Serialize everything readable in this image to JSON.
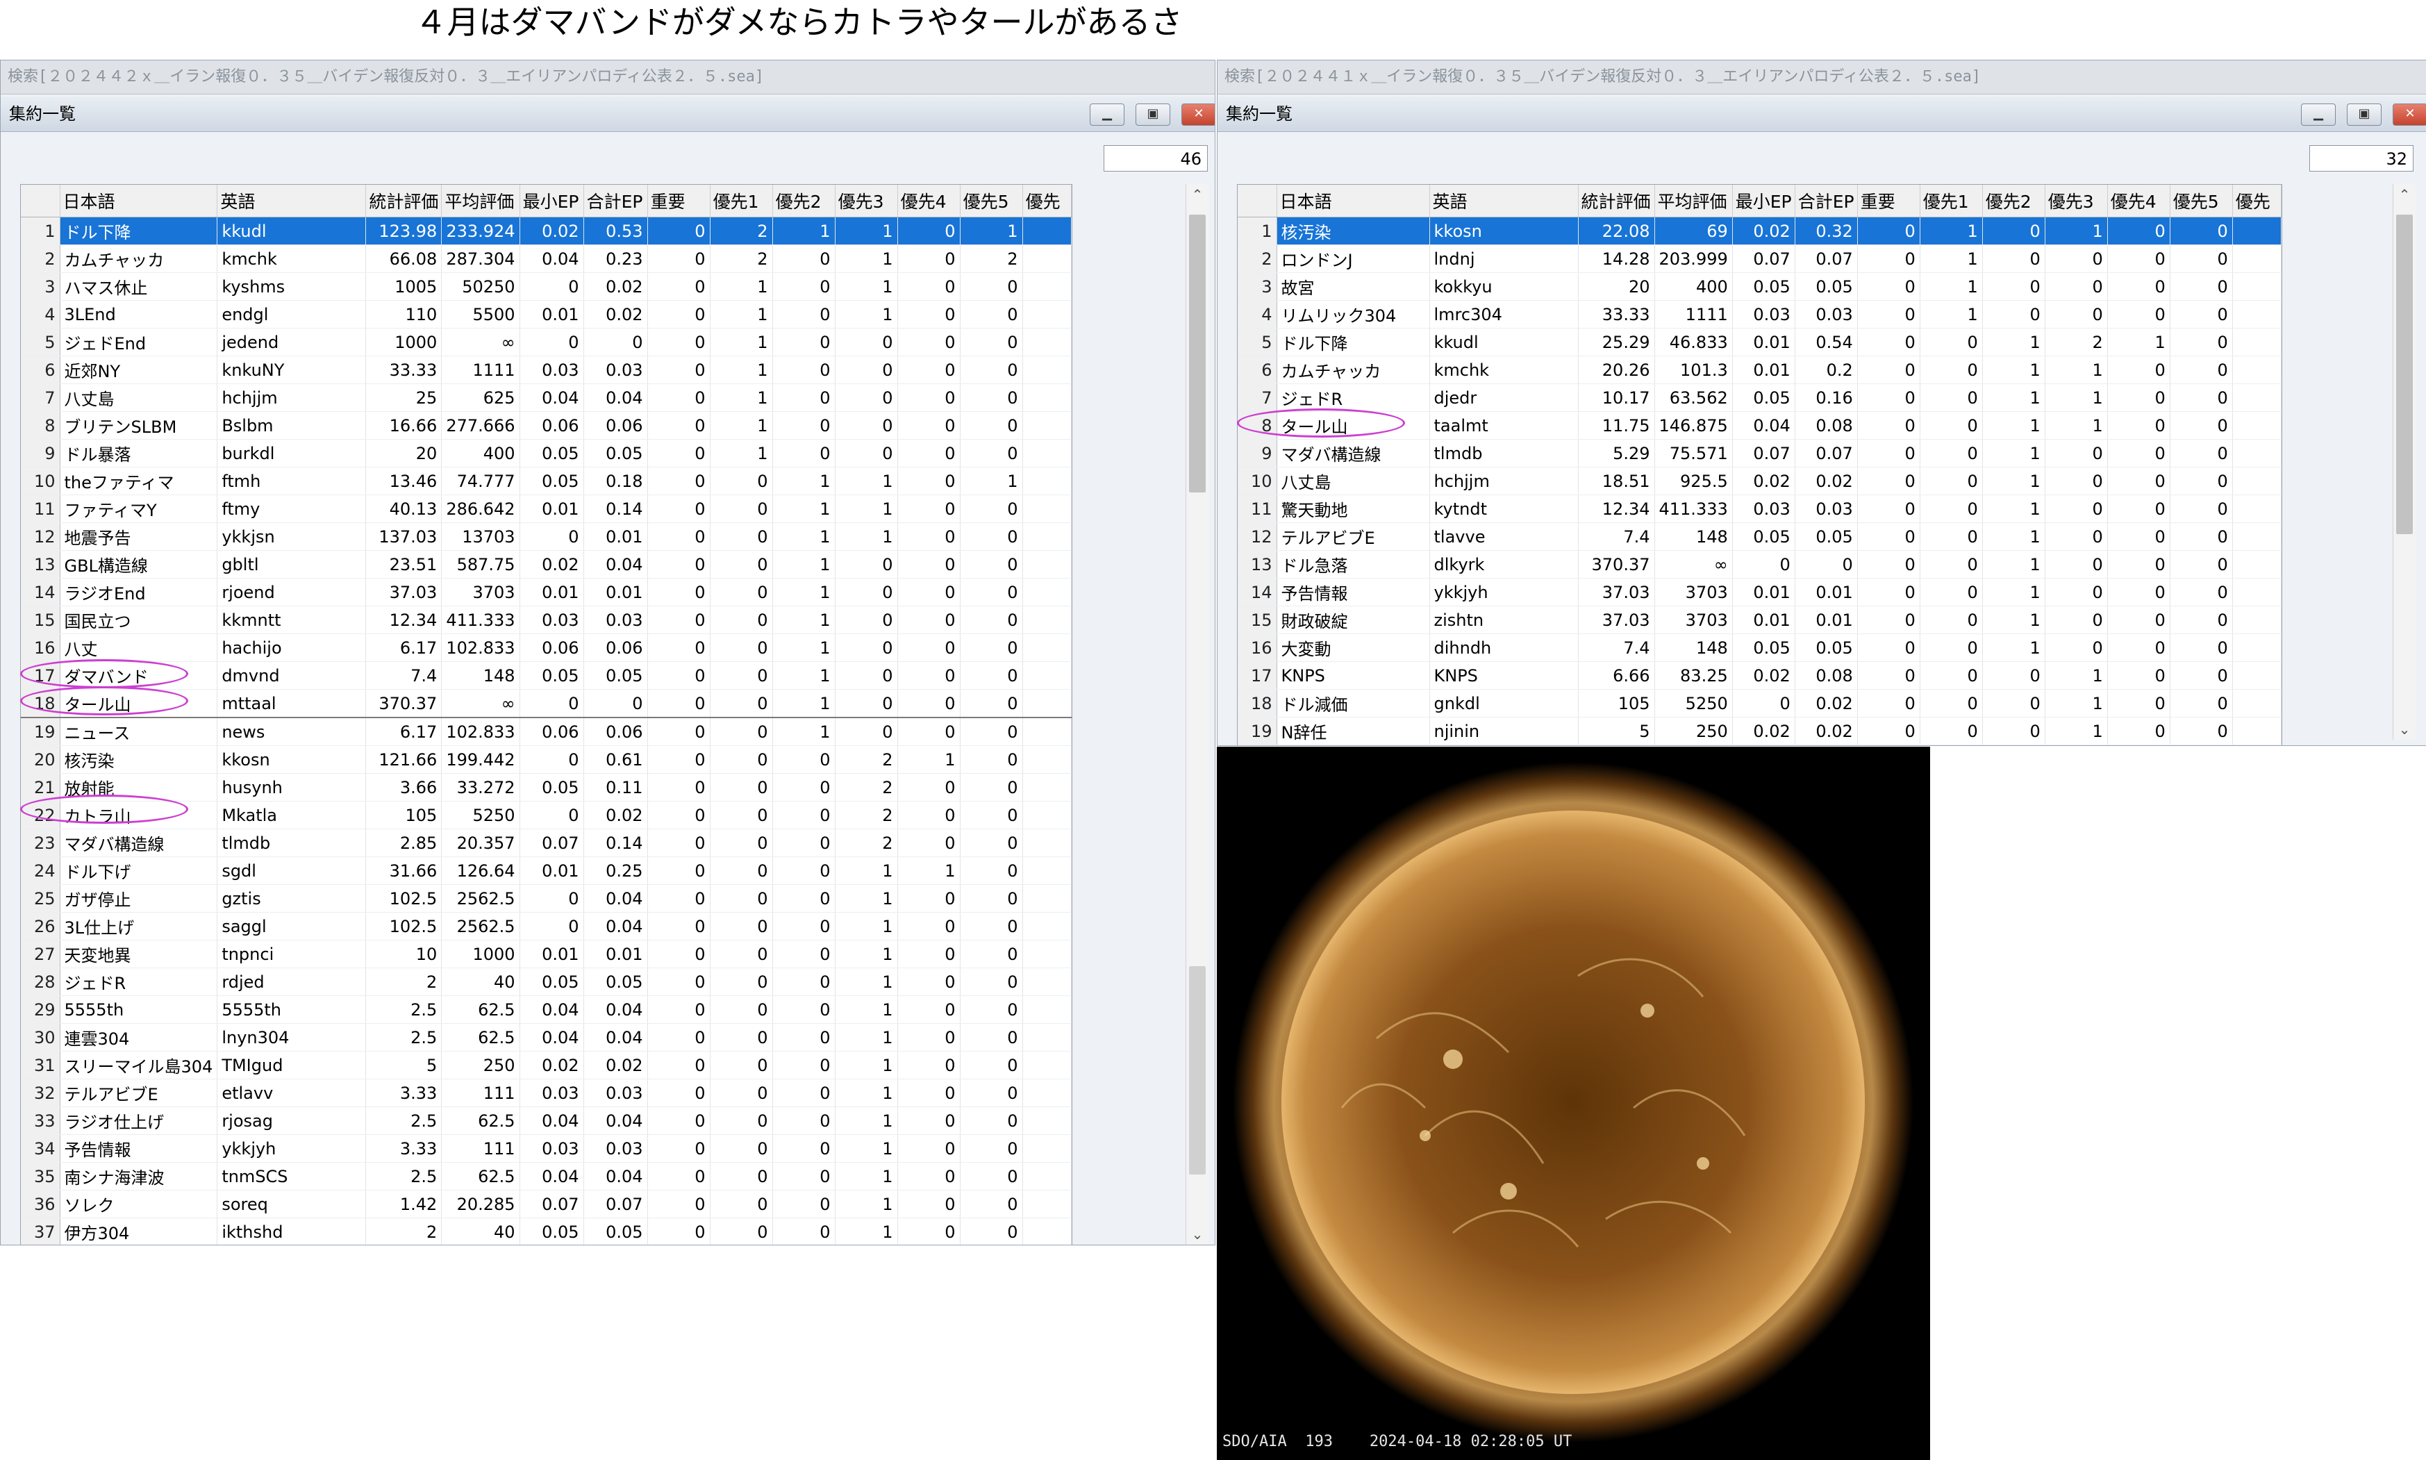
{
  "title": "４月はダマバンドがダメならカトラやタールがあるさ",
  "left": {
    "search_text": "検索[２０２４４２ｘ＿イラン報復０．３５＿バイデン報復反対０．３＿エイリアンパロディ公表２．５.sea]",
    "window_title": "集約一覧",
    "count": "46",
    "columns": [
      "日本語",
      "英語",
      "統計評価",
      "平均評価",
      "最小EP",
      "合計EP",
      "重要",
      "優先1",
      "優先2",
      "優先3",
      "優先4",
      "優先5",
      "優先"
    ],
    "rows": [
      [
        "1",
        "ドル下降",
        "kkudl",
        "123.98",
        "233.924",
        "0.02",
        "0.53",
        "0",
        "2",
        "1",
        "1",
        "0",
        "1",
        ""
      ],
      [
        "2",
        "カムチャッカ",
        "kmchk",
        "66.08",
        "287.304",
        "0.04",
        "0.23",
        "0",
        "2",
        "0",
        "1",
        "0",
        "2",
        ""
      ],
      [
        "3",
        "ハマス休止",
        "kyshms",
        "1005",
        "50250",
        "0",
        "0.02",
        "0",
        "1",
        "0",
        "1",
        "0",
        "0",
        ""
      ],
      [
        "4",
        "3LEnd",
        "endgl",
        "110",
        "5500",
        "0.01",
        "0.02",
        "0",
        "1",
        "0",
        "1",
        "0",
        "0",
        ""
      ],
      [
        "5",
        "ジェドEnd",
        "jedend",
        "1000",
        "∞",
        "0",
        "0",
        "0",
        "1",
        "0",
        "0",
        "0",
        "0",
        ""
      ],
      [
        "6",
        "近郊NY",
        "knkuNY",
        "33.33",
        "1111",
        "0.03",
        "0.03",
        "0",
        "1",
        "0",
        "0",
        "0",
        "0",
        ""
      ],
      [
        "7",
        "八丈島",
        "hchjjm",
        "25",
        "625",
        "0.04",
        "0.04",
        "0",
        "1",
        "0",
        "0",
        "0",
        "0",
        ""
      ],
      [
        "8",
        "ブリテンSLBM",
        "Bslbm",
        "16.66",
        "277.666",
        "0.06",
        "0.06",
        "0",
        "1",
        "0",
        "0",
        "0",
        "0",
        ""
      ],
      [
        "9",
        "ドル暴落",
        "burkdl",
        "20",
        "400",
        "0.05",
        "0.05",
        "0",
        "1",
        "0",
        "0",
        "0",
        "0",
        ""
      ],
      [
        "10",
        "theファティマ",
        "ftmh",
        "13.46",
        "74.777",
        "0.05",
        "0.18",
        "0",
        "0",
        "1",
        "1",
        "0",
        "1",
        ""
      ],
      [
        "11",
        "ファティマY",
        "ftmy",
        "40.13",
        "286.642",
        "0.01",
        "0.14",
        "0",
        "0",
        "1",
        "1",
        "0",
        "0",
        ""
      ],
      [
        "12",
        "地震予告",
        "ykkjsn",
        "137.03",
        "13703",
        "0",
        "0.01",
        "0",
        "0",
        "1",
        "1",
        "0",
        "0",
        ""
      ],
      [
        "13",
        "GBL構造線",
        "gbltl",
        "23.51",
        "587.75",
        "0.02",
        "0.04",
        "0",
        "0",
        "1",
        "0",
        "0",
        "0",
        ""
      ],
      [
        "14",
        "ラジオEnd",
        "rjoend",
        "37.03",
        "3703",
        "0.01",
        "0.01",
        "0",
        "0",
        "1",
        "0",
        "0",
        "0",
        ""
      ],
      [
        "15",
        "国民立つ",
        "kkmntt",
        "12.34",
        "411.333",
        "0.03",
        "0.03",
        "0",
        "0",
        "1",
        "0",
        "0",
        "0",
        ""
      ],
      [
        "16",
        "八丈",
        "hachijo",
        "6.17",
        "102.833",
        "0.06",
        "0.06",
        "0",
        "0",
        "1",
        "0",
        "0",
        "0",
        ""
      ],
      [
        "17",
        "ダマバンド",
        "dmvnd",
        "7.4",
        "148",
        "0.05",
        "0.05",
        "0",
        "0",
        "1",
        "0",
        "0",
        "0",
        ""
      ],
      [
        "18",
        "タール山",
        "mttaal",
        "370.37",
        "∞",
        "0",
        "0",
        "0",
        "0",
        "1",
        "0",
        "0",
        "0",
        ""
      ],
      [
        "19",
        "ニュース",
        "news",
        "6.17",
        "102.833",
        "0.06",
        "0.06",
        "0",
        "0",
        "1",
        "0",
        "0",
        "0",
        ""
      ],
      [
        "20",
        "核汚染",
        "kkosn",
        "121.66",
        "199.442",
        "0",
        "0.61",
        "0",
        "0",
        "0",
        "2",
        "1",
        "0",
        ""
      ],
      [
        "21",
        "放射能",
        "husynh",
        "3.66",
        "33.272",
        "0.05",
        "0.11",
        "0",
        "0",
        "0",
        "2",
        "0",
        "0",
        ""
      ],
      [
        "22",
        "カトラ山",
        "Mkatla",
        "105",
        "5250",
        "0",
        "0.02",
        "0",
        "0",
        "0",
        "2",
        "0",
        "0",
        ""
      ],
      [
        "23",
        "マダバ構造線",
        "tlmdb",
        "2.85",
        "20.357",
        "0.07",
        "0.14",
        "0",
        "0",
        "0",
        "2",
        "0",
        "0",
        ""
      ],
      [
        "24",
        "ドル下げ",
        "sgdl",
        "31.66",
        "126.64",
        "0.01",
        "0.25",
        "0",
        "0",
        "0",
        "1",
        "1",
        "0",
        ""
      ],
      [
        "25",
        "ガザ停止",
        "gztis",
        "102.5",
        "2562.5",
        "0",
        "0.04",
        "0",
        "0",
        "0",
        "1",
        "0",
        "0",
        ""
      ],
      [
        "26",
        "3L仕上げ",
        "saggl",
        "102.5",
        "2562.5",
        "0",
        "0.04",
        "0",
        "0",
        "0",
        "1",
        "0",
        "0",
        ""
      ],
      [
        "27",
        "天変地異",
        "tnpnci",
        "10",
        "1000",
        "0.01",
        "0.01",
        "0",
        "0",
        "0",
        "1",
        "0",
        "0",
        ""
      ],
      [
        "28",
        "ジェドR",
        "rdjed",
        "2",
        "40",
        "0.05",
        "0.05",
        "0",
        "0",
        "0",
        "1",
        "0",
        "0",
        ""
      ],
      [
        "29",
        "5555th",
        "5555th",
        "2.5",
        "62.5",
        "0.04",
        "0.04",
        "0",
        "0",
        "0",
        "1",
        "0",
        "0",
        ""
      ],
      [
        "30",
        "連雲304",
        "lnyn304",
        "2.5",
        "62.5",
        "0.04",
        "0.04",
        "0",
        "0",
        "0",
        "1",
        "0",
        "0",
        ""
      ],
      [
        "31",
        "スリーマイル島304",
        "TMIgud",
        "5",
        "250",
        "0.02",
        "0.02",
        "0",
        "0",
        "0",
        "1",
        "0",
        "0",
        ""
      ],
      [
        "32",
        "テルアビブE",
        "etlavv",
        "3.33",
        "111",
        "0.03",
        "0.03",
        "0",
        "0",
        "0",
        "1",
        "0",
        "0",
        ""
      ],
      [
        "33",
        "ラジオ仕上げ",
        "rjosag",
        "2.5",
        "62.5",
        "0.04",
        "0.04",
        "0",
        "0",
        "0",
        "1",
        "0",
        "0",
        ""
      ],
      [
        "34",
        "予告情報",
        "ykkjyh",
        "3.33",
        "111",
        "0.03",
        "0.03",
        "0",
        "0",
        "0",
        "1",
        "0",
        "0",
        ""
      ],
      [
        "35",
        "南シナ海津波",
        "tnmSCS",
        "2.5",
        "62.5",
        "0.04",
        "0.04",
        "0",
        "0",
        "0",
        "1",
        "0",
        "0",
        ""
      ],
      [
        "36",
        "ソレク",
        "soreq",
        "1.42",
        "20.285",
        "0.07",
        "0.07",
        "0",
        "0",
        "0",
        "1",
        "0",
        "0",
        ""
      ],
      [
        "37",
        "伊方304",
        "ikthshd",
        "2",
        "40",
        "0.05",
        "0.05",
        "0",
        "0",
        "0",
        "1",
        "0",
        "0",
        ""
      ]
    ]
  },
  "right": {
    "search_text": "検索[２０２４４１ｘ＿イラン報復０．３５＿バイデン報復反対０．３＿エイリアンパロディ公表２．５.sea]",
    "window_title": "集約一覧",
    "count": "32",
    "columns": [
      "日本語",
      "英語",
      "統計評価",
      "平均評価",
      "最小EP",
      "合計EP",
      "重要",
      "優先1",
      "優先2",
      "優先3",
      "優先4",
      "優先5",
      "優先"
    ],
    "rows": [
      [
        "1",
        "核汚染",
        "kkosn",
        "22.08",
        "69",
        "0.02",
        "0.32",
        "0",
        "1",
        "0",
        "1",
        "0",
        "0",
        ""
      ],
      [
        "2",
        "ロンドンJ",
        "lndnj",
        "14.28",
        "203.999",
        "0.07",
        "0.07",
        "0",
        "1",
        "0",
        "0",
        "0",
        "0",
        ""
      ],
      [
        "3",
        "故宮",
        "kokkyu",
        "20",
        "400",
        "0.05",
        "0.05",
        "0",
        "1",
        "0",
        "0",
        "0",
        "0",
        ""
      ],
      [
        "4",
        "リムリック304",
        "lmrc304",
        "33.33",
        "1111",
        "0.03",
        "0.03",
        "0",
        "1",
        "0",
        "0",
        "0",
        "0",
        ""
      ],
      [
        "5",
        "ドル下降",
        "kkudl",
        "25.29",
        "46.833",
        "0.01",
        "0.54",
        "0",
        "0",
        "1",
        "2",
        "1",
        "0",
        ""
      ],
      [
        "6",
        "カムチャッカ",
        "kmchk",
        "20.26",
        "101.3",
        "0.01",
        "0.2",
        "0",
        "0",
        "1",
        "1",
        "0",
        "0",
        ""
      ],
      [
        "7",
        "ジェドR",
        "djedr",
        "10.17",
        "63.562",
        "0.05",
        "0.16",
        "0",
        "0",
        "1",
        "1",
        "0",
        "0",
        ""
      ],
      [
        "8",
        "タール山",
        "taalmt",
        "11.75",
        "146.875",
        "0.04",
        "0.08",
        "0",
        "0",
        "1",
        "1",
        "0",
        "0",
        ""
      ],
      [
        "9",
        "マダバ構造線",
        "tlmdb",
        "5.29",
        "75.571",
        "0.07",
        "0.07",
        "0",
        "0",
        "1",
        "0",
        "0",
        "0",
        ""
      ],
      [
        "10",
        "八丈島",
        "hchjjm",
        "18.51",
        "925.5",
        "0.02",
        "0.02",
        "0",
        "0",
        "1",
        "0",
        "0",
        "0",
        ""
      ],
      [
        "11",
        "驚天動地",
        "kytndt",
        "12.34",
        "411.333",
        "0.03",
        "0.03",
        "0",
        "0",
        "1",
        "0",
        "0",
        "0",
        ""
      ],
      [
        "12",
        "テルアビブE",
        "tlavve",
        "7.4",
        "148",
        "0.05",
        "0.05",
        "0",
        "0",
        "1",
        "0",
        "0",
        "0",
        ""
      ],
      [
        "13",
        "ドル急落",
        "dlkyrk",
        "370.37",
        "∞",
        "0",
        "0",
        "0",
        "0",
        "1",
        "0",
        "0",
        "0",
        ""
      ],
      [
        "14",
        "予告情報",
        "ykkjyh",
        "37.03",
        "3703",
        "0.01",
        "0.01",
        "0",
        "0",
        "1",
        "0",
        "0",
        "0",
        ""
      ],
      [
        "15",
        "財政破綻",
        "zishtn",
        "37.03",
        "3703",
        "0.01",
        "0.01",
        "0",
        "0",
        "1",
        "0",
        "0",
        "0",
        ""
      ],
      [
        "16",
        "大変動",
        "dihndh",
        "7.4",
        "148",
        "0.05",
        "0.05",
        "0",
        "0",
        "1",
        "0",
        "0",
        "0",
        ""
      ],
      [
        "17",
        "KNPS",
        "KNPS",
        "6.66",
        "83.25",
        "0.02",
        "0.08",
        "0",
        "0",
        "0",
        "1",
        "0",
        "0",
        ""
      ],
      [
        "18",
        "ドル減価",
        "gnkdl",
        "105",
        "5250",
        "0",
        "0.02",
        "0",
        "0",
        "0",
        "1",
        "0",
        "0",
        ""
      ],
      [
        "19",
        "N辞任",
        "njinin",
        "5",
        "250",
        "0.02",
        "0.02",
        "0",
        "0",
        "0",
        "1",
        "0",
        "0",
        ""
      ]
    ]
  },
  "sun_caption": "SDO/AIA  193    2024-04-18 02:28:05 UT",
  "colors": {
    "selection": "#1874d6",
    "highlight_ellipse": "#cc3fd1"
  }
}
